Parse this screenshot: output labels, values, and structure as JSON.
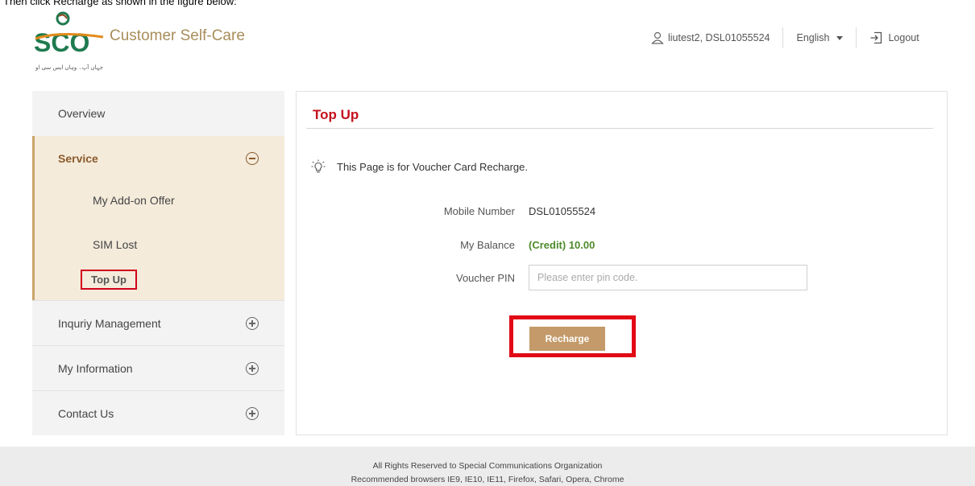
{
  "caption": "Then click Recharge as shown in the figure below:",
  "header": {
    "brand_title": "Customer Self-Care",
    "logo_text": "SCO",
    "logo_tagline": "جہاں آپ۔ وہاں ایس سی او",
    "user_label": "liutest2, DSL01055524",
    "language": "English",
    "logout_label": "Logout"
  },
  "sidebar": {
    "items": [
      {
        "label": "Overview"
      },
      {
        "label": "Service",
        "expanded": true
      },
      {
        "label": "Inquriy Management"
      },
      {
        "label": "My Information"
      },
      {
        "label": "Contact Us"
      }
    ],
    "service_sub_items": [
      {
        "label": "My Add-on Offer"
      },
      {
        "label": "SIM Lost"
      },
      {
        "label": "Top Up",
        "active": true
      }
    ]
  },
  "main": {
    "title": "Top Up",
    "tip": "This Page is for Voucher Card Recharge.",
    "mobile_label": "Mobile Number",
    "mobile_value": "DSL01055524",
    "balance_label": "My Balance",
    "balance_value": "(Credit) 10.00",
    "voucher_label": "Voucher PIN",
    "voucher_placeholder": "Please enter pin code.",
    "voucher_value": "",
    "recharge_label": "Recharge"
  },
  "footer": {
    "line1": "All Rights Reserved to Special Communications Organization",
    "line2": "Recommended browsers IE9, IE10, IE11, Firefox, Safari, Opera, Chrome"
  },
  "colors": {
    "brand": "#a88d5a",
    "accent_red": "#c5101c",
    "highlight_red": "#e10a15",
    "service_bg": "#f4ebdb",
    "service_text": "#8b5a2b",
    "balance_green": "#4f8a2b",
    "button_bg": "#c49a6a"
  }
}
